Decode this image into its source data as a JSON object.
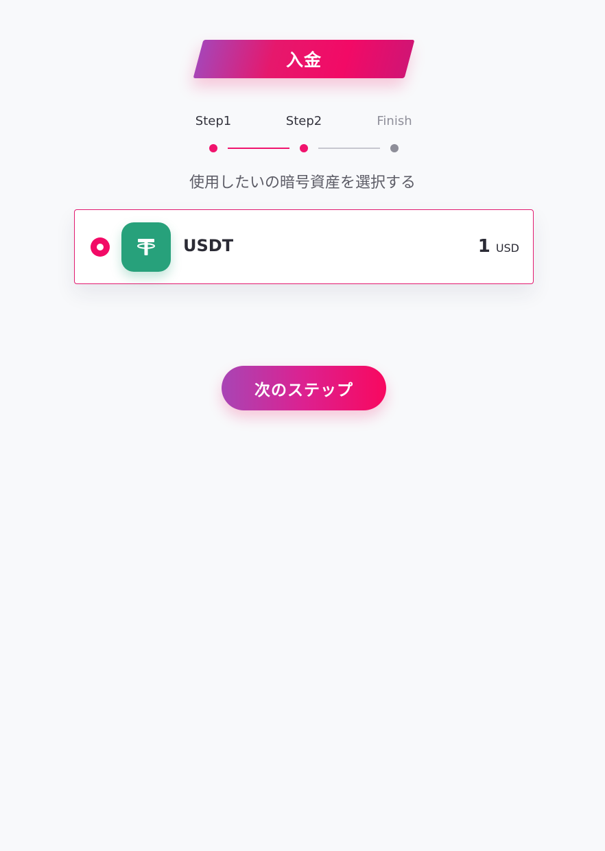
{
  "header": {
    "title": "入金"
  },
  "stepper": {
    "steps": [
      {
        "label": "Step1",
        "state": "done"
      },
      {
        "label": "Step2",
        "state": "active"
      },
      {
        "label": "Finish",
        "state": "pending"
      }
    ]
  },
  "main": {
    "subtitle": "使用したいの暗号資産を選択する",
    "assets": [
      {
        "symbol": "USDT",
        "amount": "1",
        "unit": "USD",
        "icon": "tether-icon",
        "selected": true,
        "color": "#27a17b"
      }
    ],
    "next_label": "次のステップ"
  },
  "colors": {
    "accent": "#f0136d",
    "gradient_start": "#a844b6",
    "gradient_end": "#f8085f",
    "inactive": "#8e8e99",
    "background": "#f8f9fb"
  }
}
